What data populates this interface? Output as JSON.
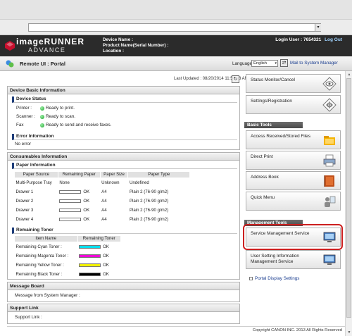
{
  "header": {
    "logo_line1": "imageRUNNER",
    "logo_line2": "ADVANCE",
    "device_name_label": "Device Name :",
    "product_name_label": "Product Name(Serial Number) :",
    "location_label": "Location :",
    "login_user": "Login User : 7654321",
    "logout": "Log Out"
  },
  "portalbar": {
    "title": "Remote UI : Portal",
    "language_label": "Language:",
    "language_value": "English",
    "mail_link": "Mail to System Manager"
  },
  "last_updated": "Last Updated : 08/20/2014 11:58:38 AM",
  "device_basic": {
    "title": "Device Basic Information",
    "device_status": {
      "title": "Device Status",
      "rows": [
        {
          "label": "Printer :",
          "status": "Ready to print."
        },
        {
          "label": "Scanner :",
          "status": "Ready to scan."
        },
        {
          "label": "Fax",
          "status": "Ready to send and receive faxes."
        }
      ]
    },
    "error_info": {
      "title": "Error Information",
      "text": "No error"
    }
  },
  "consumables": {
    "title": "Consumables Information",
    "paper": {
      "title": "Paper Information",
      "headers": [
        "Paper Source",
        "Remaining Paper",
        "Paper Size",
        "Paper Type"
      ],
      "rows": [
        {
          "source": "Multi-Purpose Tray",
          "remaining": "None",
          "size": "Unknown",
          "type": "Undefined"
        },
        {
          "source": "Drawer 1",
          "remaining": "OK",
          "size": "A4",
          "type": "Plain 2 (76-90 g/m2)"
        },
        {
          "source": "Drawer 2",
          "remaining": "OK",
          "size": "A4",
          "type": "Plain 2 (76-90 g/m2)"
        },
        {
          "source": "Drawer 3",
          "remaining": "OK",
          "size": "A4",
          "type": "Plain 2 (76-90 g/m2)"
        },
        {
          "source": "Drawer 4",
          "remaining": "OK",
          "size": "A4",
          "type": "Plain 2 (76-90 g/m2)"
        }
      ]
    },
    "toner": {
      "title": "Remaining Toner",
      "headers": [
        "Item Name",
        "Remaining Toner"
      ],
      "rows": [
        {
          "name": "Remaining Cyan Toner :",
          "status": "OK",
          "color": "#00e0f0"
        },
        {
          "name": "Remaining Magenta Toner :",
          "status": "OK",
          "color": "#f000d8"
        },
        {
          "name": "Remaining Yellow Toner :",
          "status": "OK",
          "color": "#f2f200"
        },
        {
          "name": "Remaining Black Toner :",
          "status": "OK",
          "color": "#000000"
        }
      ]
    }
  },
  "message_board": {
    "title": "Message Board",
    "text": "Message from System Manager :"
  },
  "support_link": {
    "title": "Support Link",
    "text": "Support Link :"
  },
  "right": {
    "status_monitor": "Status Monitor/Cancel",
    "settings": "Settings/Registration",
    "basic_tools_hdr": "Basic Tools",
    "access_files": "Access Received/Stored Files",
    "direct_print": "Direct Print",
    "address_book": "Address Book",
    "quick_menu": "Quick Menu",
    "mgmt_tools_hdr": "Management Tools",
    "service_mgmt": "Service Management Service",
    "user_setting": "User Setting Information Management Service",
    "portal_display": "Portal Display Settings"
  },
  "copyright": "Copyright CANON INC. 2013 All Rights Reserved",
  "colors": {
    "header_bg": "#2b2b2b",
    "highlight": "#cc1f1f",
    "link": "#1a3d8f"
  }
}
